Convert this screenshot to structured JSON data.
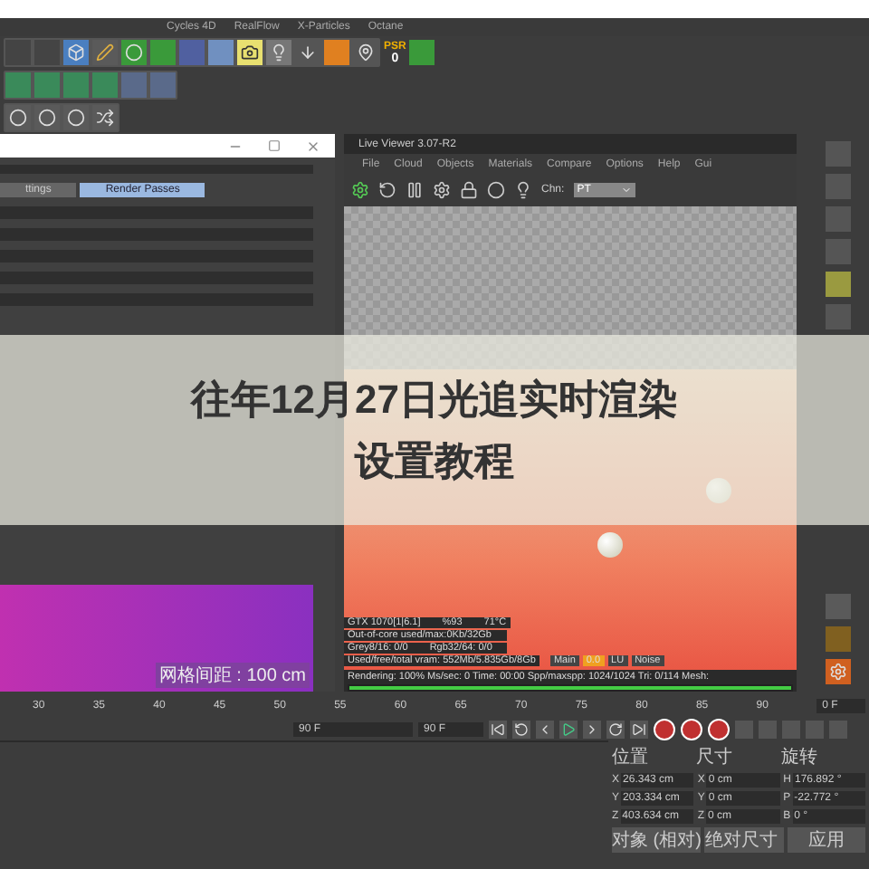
{
  "menu_bar": {
    "items": [
      "Cycles 4D",
      "RealFlow",
      "X-Particles",
      "Octane"
    ]
  },
  "toolbar": {
    "psr_label": "PSR",
    "psr_value": "0"
  },
  "render_settings": {
    "tabs": [
      {
        "label": "ttings",
        "selected": false
      },
      {
        "label": "Render Passes",
        "selected": true
      }
    ],
    "preview_label": "网格间距 : 100 cm"
  },
  "live_viewer": {
    "title": "Live Viewer 3.07-R2",
    "menu": [
      "File",
      "Cloud",
      "Objects",
      "Materials",
      "Compare",
      "Options",
      "Help",
      "Gui"
    ],
    "channel_label": "Chn:",
    "channel_value": "PT",
    "stats": [
      [
        "GTX 1070[1|6.1]",
        "%93",
        "71°C"
      ],
      [
        "Out-of-core used/max:0Kb/32Gb"
      ],
      [
        "Grey8/16: 0/0",
        "Rgb32/64: 0/0"
      ],
      [
        "Used/free/total vram: 552Mb/5.835Gb/8Gb"
      ]
    ],
    "legend": [
      {
        "label": "Main",
        "selected": false
      },
      {
        "label": "0.0",
        "selected": true
      },
      {
        "label": "LU",
        "selected": false
      },
      {
        "label": "Noise",
        "selected": false
      }
    ],
    "status_line": "Rendering: 100%  Ms/sec: 0  Time: 00:00  Spp/maxspp: 1024/1024  Tri: 0/114  Mesh:",
    "progress": {
      "level": 1
    }
  },
  "title_overlay": {
    "lines": [
      "往年12月27日光追实时渲染",
      "设置教程"
    ]
  },
  "timeline": {
    "ticks": [
      "30",
      "35",
      "40",
      "45",
      "50",
      "55",
      "60",
      "65",
      "70",
      "75",
      "80",
      "85",
      "90"
    ],
    "current_frame": "0 F",
    "start_field": "90 F",
    "end_field": "90 F"
  },
  "coordinates": {
    "headers": [
      "位置",
      "尺寸",
      "旋转"
    ],
    "rows": [
      {
        "axis": "X",
        "position": "26.343 cm",
        "size_axis": "X",
        "size": "0 cm",
        "rot_axis": "H",
        "rotation": "176.892 °"
      },
      {
        "axis": "Y",
        "position": "203.334 cm",
        "size_axis": "Y",
        "size": "0 cm",
        "rot_axis": "P",
        "rotation": "-22.772 °"
      },
      {
        "axis": "Z",
        "position": "403.634 cm",
        "size_axis": "Z",
        "size": "0 cm",
        "rot_axis": "B",
        "rotation": "0 °"
      }
    ],
    "mode_dropdown": "对象 (相对)",
    "size_dropdown": "绝对尺寸",
    "apply_button": "应用"
  }
}
